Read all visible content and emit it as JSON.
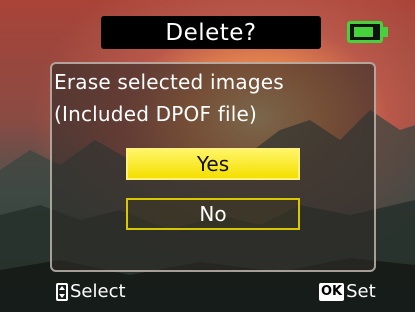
{
  "header": {
    "title": "Delete?",
    "battery_icon": "battery-icon",
    "battery_color": "#46d23a"
  },
  "dialog": {
    "message_line1": "Erase selected images",
    "message_line2": "(Included DPOF file)",
    "yes_label": "Yes",
    "no_label": "No",
    "selected_option": "Yes",
    "highlight_color": "#f5df00"
  },
  "footer": {
    "select_icon": "up-down-arrows-icon",
    "select_label": "Select",
    "ok_icon_text": "OK",
    "set_label": "Set"
  }
}
